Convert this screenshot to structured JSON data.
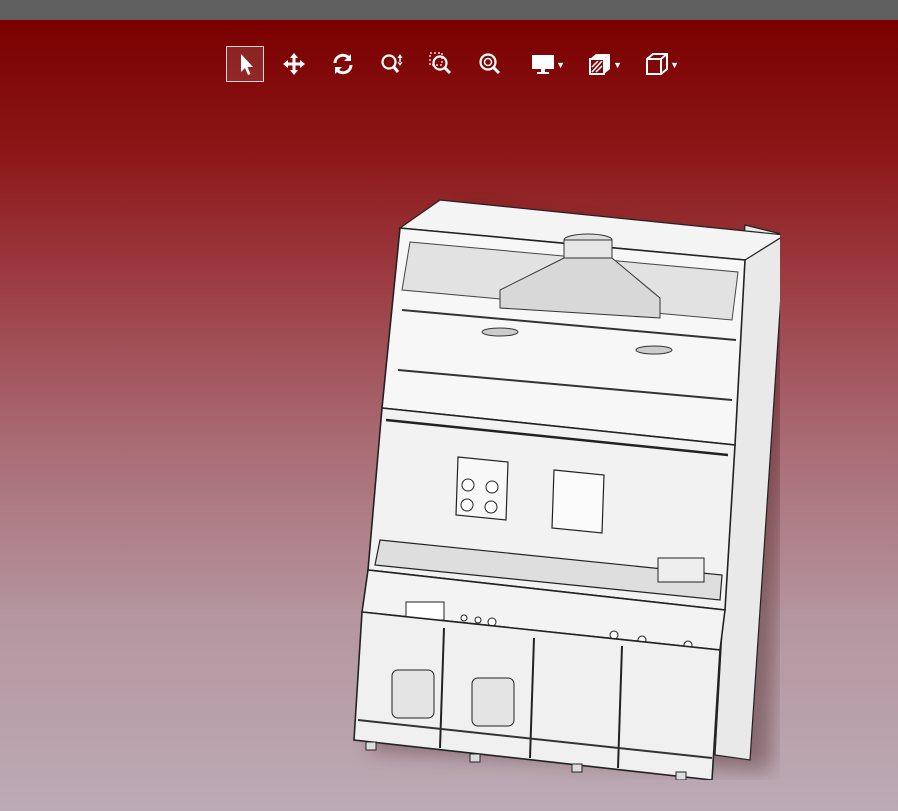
{
  "toolbar": {
    "items": [
      {
        "name": "select-arrow-icon",
        "active": true
      },
      {
        "name": "pan-move-icon"
      },
      {
        "name": "rotate-icon"
      },
      {
        "name": "zoom-in-out-icon"
      },
      {
        "name": "zoom-window-icon"
      },
      {
        "name": "zoom-fit-icon"
      },
      {
        "name": "display-monitor-icon",
        "dropdown": true
      },
      {
        "name": "section-cube-icon",
        "dropdown": true
      },
      {
        "name": "view-cube-icon",
        "dropdown": true
      }
    ]
  },
  "viewport": {
    "background_top": "#7a0000",
    "background_bottom": "#bcaab4"
  },
  "model": {
    "description_icon": "fume-hood-cabinet-3d-model"
  },
  "colors": {
    "topbar": "#5f5f5f",
    "icon": "#ffffff"
  }
}
